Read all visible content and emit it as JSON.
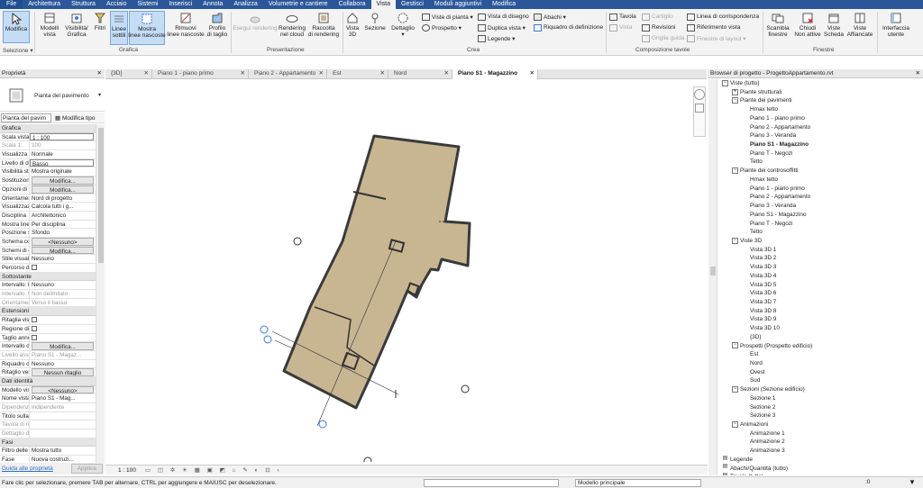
{
  "menu": [
    "File",
    "Architettura",
    "Struttura",
    "Acciaio",
    "Sistemi",
    "Inserisci",
    "Annota",
    "Analizza",
    "Volumetrie e cantiere",
    "Collabora",
    "Vista",
    "Gestisci",
    "Moduli aggiuntivi",
    "Modifica"
  ],
  "ribbon": {
    "modify_label": "Modifica",
    "selection_panel": "Selezione ▾",
    "models_view": "Modelli\nvista",
    "visibility": "Visibilità/\nGrafica",
    "filters": "Filtri",
    "thin_lines": "Linee\nsottili",
    "show_hidden": "Mostra\nlinee nascoste",
    "remove_hidden": "Rimuovi\nlinee nascoste",
    "cut_profile": "Profilo\ndi taglio",
    "grafica_panel": "Grafica",
    "render": "Esegui rendering",
    "render_cloud": "Rendering\nnel cloud",
    "render_gallery": "Raccolta\ndi rendering",
    "presentazione_panel": "Presentazione",
    "view3d": "Vista\n3D",
    "section": "Sezione",
    "callout": "Dettaglio\n▾",
    "plan_views": "Viste di pianta ▾",
    "elevation": "Prospetto ▾",
    "drafting_view": "Vista di disegno",
    "duplicate_view": "Duplica vista ▾",
    "legends": "Legende ▾",
    "schedules": "Abachi ▾",
    "scope_box": "Riquadro di definizione",
    "crea_panel": "Crea",
    "sheet": "Tavola",
    "view": "Vista",
    "title_block": "Cartiglio",
    "revisions": "Revisioni",
    "guide_grid": "Griglia guida",
    "matchline": "Linea di corrispondenza",
    "view_reference": "Riferimento vista",
    "viewports": "Finestre di layout ▾",
    "sheet_panel": "Composizione tavole",
    "switch_windows": "Scambia\nfinestre",
    "close_inactive": "Chiudi\nNon attive",
    "tab_views": "Viste\nScheda",
    "tile_views": "Viste\nAffiancate",
    "user_interface": "Interfaccia\nutente",
    "finestre_panel": "Finestre"
  },
  "properties": {
    "header": "Proprietà",
    "type_name": "Pianta del pavimento",
    "filter_value": "Pianta del pavim",
    "edit_type": "Modifica tipo",
    "sections": [
      {
        "title": "Grafica",
        "rows": [
          {
            "k": "Scala vista",
            "v": "1 : 100",
            "style": "box"
          },
          {
            "k": "Scala 1:",
            "v": "100",
            "gray": true
          },
          {
            "k": "Visualizza mo...",
            "v": "Normale"
          },
          {
            "k": "Livello di dett...",
            "v": "Basso",
            "style": "box"
          },
          {
            "k": "Visibilità strati...",
            "v": "Mostra originale"
          },
          {
            "k": "Sostituzioni vi...",
            "v": "Modifica...",
            "style": "btn"
          },
          {
            "k": "Opzioni di vis...",
            "v": "Modifica...",
            "style": "btn"
          },
          {
            "k": "Orientamento",
            "v": "Nord di progetto"
          },
          {
            "k": "Visualizzazion...",
            "v": "Calcola tutti i g..."
          },
          {
            "k": "Disciplina",
            "v": "Architettonico"
          },
          {
            "k": "Mostra linee n...",
            "v": "Per disciplina"
          },
          {
            "k": "Posizione sch...",
            "v": "Sfondo"
          },
          {
            "k": "Schema colori",
            "v": "<Nessuno>",
            "style": "btn"
          },
          {
            "k": "Schemi di col...",
            "v": "Modifica...",
            "style": "btn"
          },
          {
            "k": "Stile visualizza...",
            "v": "Nessuno"
          },
          {
            "k": "Percorso del s...",
            "v": "",
            "style": "cb"
          }
        ]
      },
      {
        "title": "Sottostante",
        "rows": [
          {
            "k": "Intervallo: live...",
            "v": "Nessuno"
          },
          {
            "k": "Intervallo: live...",
            "v": "Non delimitato",
            "gray": true
          },
          {
            "k": "Orientamento...",
            "v": "Verso il basso",
            "gray": true
          }
        ]
      },
      {
        "title": "Estensioni",
        "rows": [
          {
            "k": "Ritaglia vista",
            "v": "",
            "style": "cb"
          },
          {
            "k": "Regione di ta...",
            "v": "",
            "style": "cb"
          },
          {
            "k": "Taglio annota...",
            "v": "",
            "style": "cb"
          },
          {
            "k": "Intervallo di vi...",
            "v": "Modifica...",
            "style": "btn"
          },
          {
            "k": "Livello associa...",
            "v": "Piano S1 - Magaz...",
            "gray": true
          },
          {
            "k": "Riquadro di d...",
            "v": "Nessuno"
          },
          {
            "k": "Ritaglio vertic...",
            "v": "Nessun ritaglio",
            "style": "btn"
          }
        ]
      },
      {
        "title": "Dati identità",
        "rows": [
          {
            "k": "Modello vista",
            "v": "<Nessuno>",
            "style": "btn"
          },
          {
            "k": "Nome vista",
            "v": "Piano S1 - Mag..."
          },
          {
            "k": "Dipendenza",
            "v": "Indipendente",
            "gray": true
          },
          {
            "k": "Titolo sulla ta...",
            "v": ""
          },
          {
            "k": "Tavola di riferi...",
            "v": "",
            "gray": true
          },
          {
            "k": "Dettaglio di rif...",
            "v": "",
            "gray": true
          }
        ]
      },
      {
        "title": "Fasi",
        "rows": [
          {
            "k": "Filtro delle fasi",
            "v": "Mostra tutto"
          },
          {
            "k": "Fase",
            "v": "Nuova costruzi..."
          }
        ]
      }
    ],
    "help_link": "Guida alle proprietà",
    "apply": "Applica"
  },
  "view_tabs": [
    {
      "label": "{3D}",
      "active": false
    },
    {
      "label": "Piano 1 - piano primo",
      "active": false
    },
    {
      "label": "Piano 2 - Appartamento",
      "active": false
    },
    {
      "label": "Est",
      "active": false
    },
    {
      "label": "Nord",
      "active": false
    },
    {
      "label": "Piano S1 - Magazzino",
      "active": true
    }
  ],
  "view_bar": {
    "scale": "1 : 100"
  },
  "browser": {
    "header": "Browser di progetto - ProgettoAppartamento.rvt",
    "nodes": [
      {
        "label": "Viste (tutto)",
        "lvl": 0,
        "tg": "-"
      },
      {
        "label": "Piante strutturali",
        "lvl": 1,
        "tg": "+"
      },
      {
        "label": "Piante dei pavimenti",
        "lvl": 1,
        "tg": "-"
      },
      {
        "label": "Hmax tetto",
        "lvl": 2
      },
      {
        "label": "Piano 1 - piano primo",
        "lvl": 2
      },
      {
        "label": "Piano 2 - Appartamento",
        "lvl": 2
      },
      {
        "label": "Piano 3 - Veranda",
        "lvl": 2
      },
      {
        "label": "Piano S1 - Magazzino",
        "lvl": 2,
        "bold": true
      },
      {
        "label": "Piano T - Negozi",
        "lvl": 2
      },
      {
        "label": "Tetto",
        "lvl": 2
      },
      {
        "label": "Piante dei controsoffitti",
        "lvl": 1,
        "tg": "-"
      },
      {
        "label": "Hmax tetto",
        "lvl": 2
      },
      {
        "label": "Piano 1 - piano primo",
        "lvl": 2
      },
      {
        "label": "Piano 2 - Appartamento",
        "lvl": 2
      },
      {
        "label": "Piano 3 - Veranda",
        "lvl": 2
      },
      {
        "label": "Piano S1 - Magazzino",
        "lvl": 2
      },
      {
        "label": "Piano T - Negozi",
        "lvl": 2
      },
      {
        "label": "Tetto",
        "lvl": 2
      },
      {
        "label": "Viste 3D",
        "lvl": 1,
        "tg": "-"
      },
      {
        "label": "Vista 3D 1",
        "lvl": 2
      },
      {
        "label": "Vista 3D 2",
        "lvl": 2
      },
      {
        "label": "Vista 3D 3",
        "lvl": 2
      },
      {
        "label": "Vista 3D 4",
        "lvl": 2
      },
      {
        "label": "Vista 3D 5",
        "lvl": 2
      },
      {
        "label": "Vista 3D 6",
        "lvl": 2
      },
      {
        "label": "Vista 3D 7",
        "lvl": 2
      },
      {
        "label": "Vista 3D 8",
        "lvl": 2
      },
      {
        "label": "Vista 3D 9",
        "lvl": 2
      },
      {
        "label": "Vista 3D 10",
        "lvl": 2
      },
      {
        "label": "{3D}",
        "lvl": 2
      },
      {
        "label": "Prospetti (Prospetto edificio)",
        "lvl": 1,
        "tg": "-"
      },
      {
        "label": "Est",
        "lvl": 2
      },
      {
        "label": "Nord",
        "lvl": 2
      },
      {
        "label": "Ovest",
        "lvl": 2
      },
      {
        "label": "Sud",
        "lvl": 2
      },
      {
        "label": "Sezioni (Sezione edificio)",
        "lvl": 1,
        "tg": "-"
      },
      {
        "label": "Sezione 1",
        "lvl": 2
      },
      {
        "label": "Sezione 2",
        "lvl": 2
      },
      {
        "label": "Sezione 3",
        "lvl": 2
      },
      {
        "label": "Animazioni",
        "lvl": 1,
        "tg": "-"
      },
      {
        "label": "Animazione 1",
        "lvl": 2
      },
      {
        "label": "Animazione 2",
        "lvl": 2
      },
      {
        "label": "Animazione 3",
        "lvl": 2
      },
      {
        "label": "Legende",
        "lvl": 0,
        "icon": true
      },
      {
        "label": "Abachi/Quantità (tutto)",
        "lvl": 0,
        "icon": true
      },
      {
        "label": "Tavole (tutto)",
        "lvl": 0,
        "icon": true
      }
    ]
  },
  "status": {
    "message": "Fare clic per selezionare, premere TAB per alternare, CTRL per aggiungere e MAIUSC per deselezionare.",
    "model_combo": "Modello principale",
    "zero": ":0"
  },
  "colors": {
    "accent": "#2b579a",
    "floor_fill": "#c8b592",
    "floor_edge": "#3a3a3a"
  }
}
